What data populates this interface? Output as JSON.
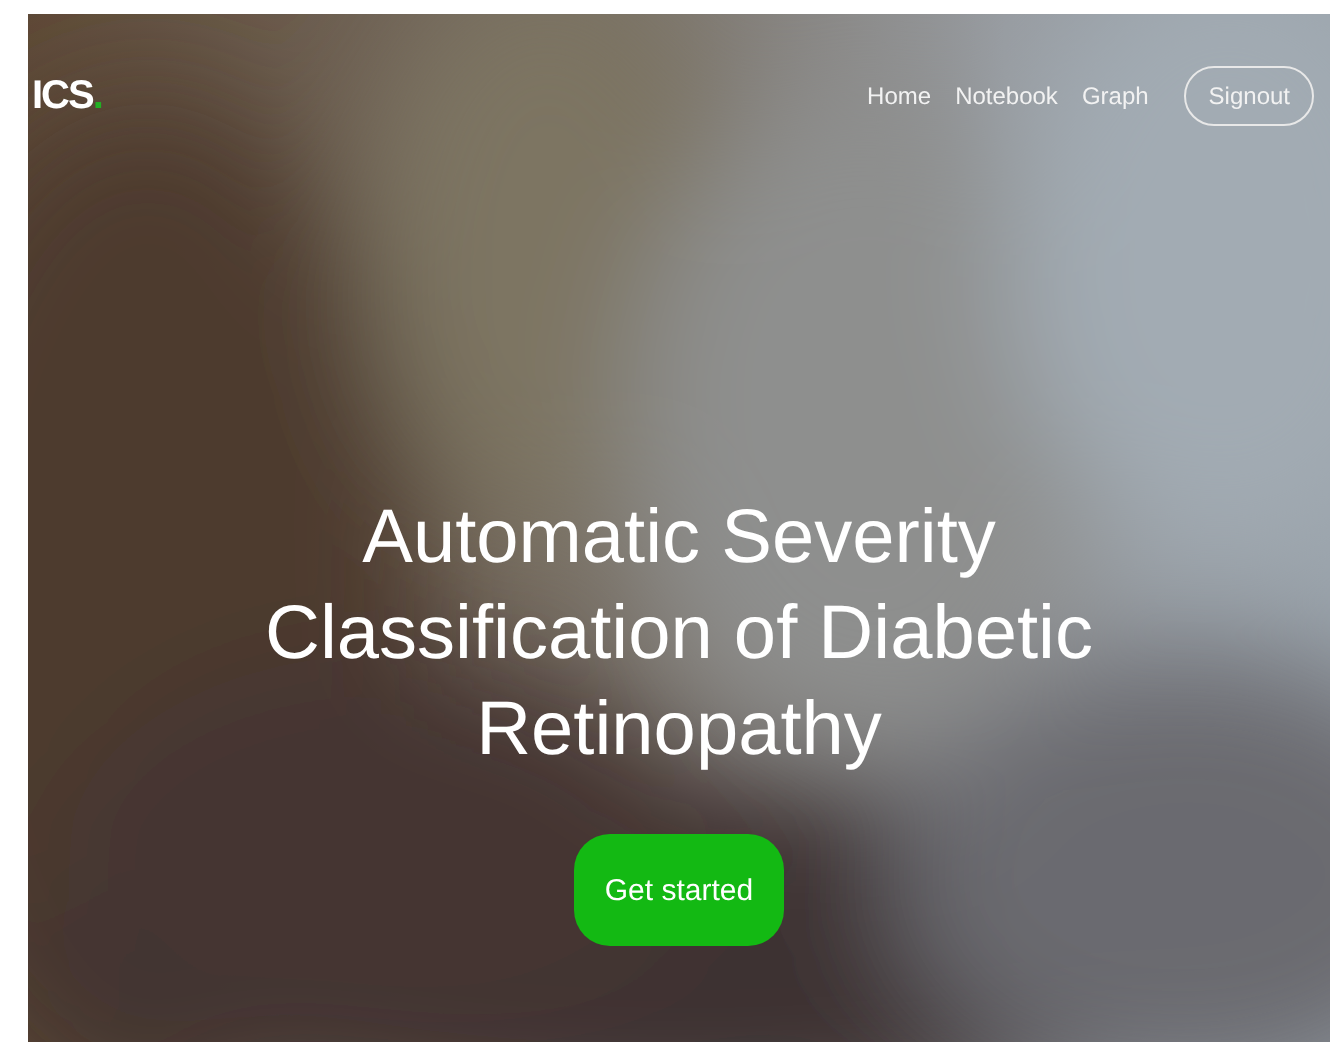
{
  "navbar": {
    "logo": {
      "text": "ICS",
      "dot": "."
    },
    "links": [
      {
        "label": "Home"
      },
      {
        "label": "Notebook"
      },
      {
        "label": "Graph"
      }
    ],
    "signout_button": "Signout"
  },
  "hero": {
    "title": "Automatic Severity Classification of Diabetic Retinopathy",
    "cta_button": "Get started"
  }
}
